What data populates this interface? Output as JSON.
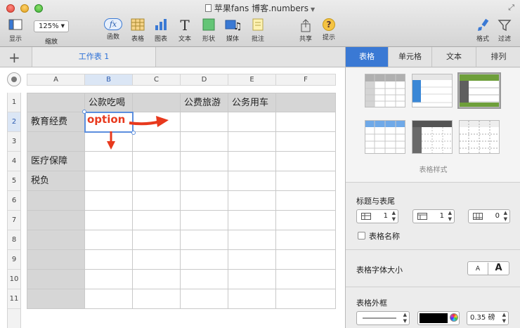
{
  "window": {
    "title": "苹果fans 博客.numbers"
  },
  "toolbar": {
    "view_label": "显示",
    "zoom_value": "125%",
    "zoom_label": "缩放",
    "function_label": "函数",
    "function_glyph": "fx",
    "table_label": "表格",
    "chart_label": "图表",
    "text_label": "文本",
    "text_glyph": "T",
    "shape_label": "形状",
    "media_label": "媒体",
    "comment_label": "批注",
    "share_label": "共享",
    "tips_label": "提示",
    "tips_glyph": "?",
    "format_label": "格式",
    "filter_label": "过滤"
  },
  "sheet_tabs": {
    "add_glyph": "+",
    "active": "工作表 1"
  },
  "grid": {
    "columns": [
      "A",
      "B",
      "C",
      "D",
      "E",
      "F"
    ],
    "rows": [
      "1",
      "2",
      "3",
      "4",
      "5",
      "6",
      "7",
      "8",
      "9",
      "10",
      "11"
    ],
    "header_row": [
      "",
      "公款吃喝",
      "",
      "公费旅游",
      "公务用车",
      ""
    ],
    "row_labels": [
      "教育经费",
      "",
      "医疗保障",
      "税负",
      "",
      "",
      "",
      "",
      "",
      ""
    ]
  },
  "annotation": {
    "text": "option",
    "color": "#e8391d"
  },
  "inspector": {
    "tabs": [
      "表格",
      "单元格",
      "文本",
      "排列"
    ],
    "styles_caption": "表格样式",
    "headers_section": "标题与表尾",
    "header_rows": "1",
    "header_cols": "1",
    "footer_rows": "0",
    "table_name_label": "表格名称",
    "font_size_section": "表格字体大小",
    "font_small": "A",
    "font_large": "A",
    "border_section": "表格外框",
    "border_width": "0.35 磅",
    "border_color": "#000000"
  },
  "colors": {
    "accent": "#3a79d4",
    "selection": "#5b8ede",
    "header_fill": "#d6d6d6",
    "style_green": "#6e9f3a"
  }
}
